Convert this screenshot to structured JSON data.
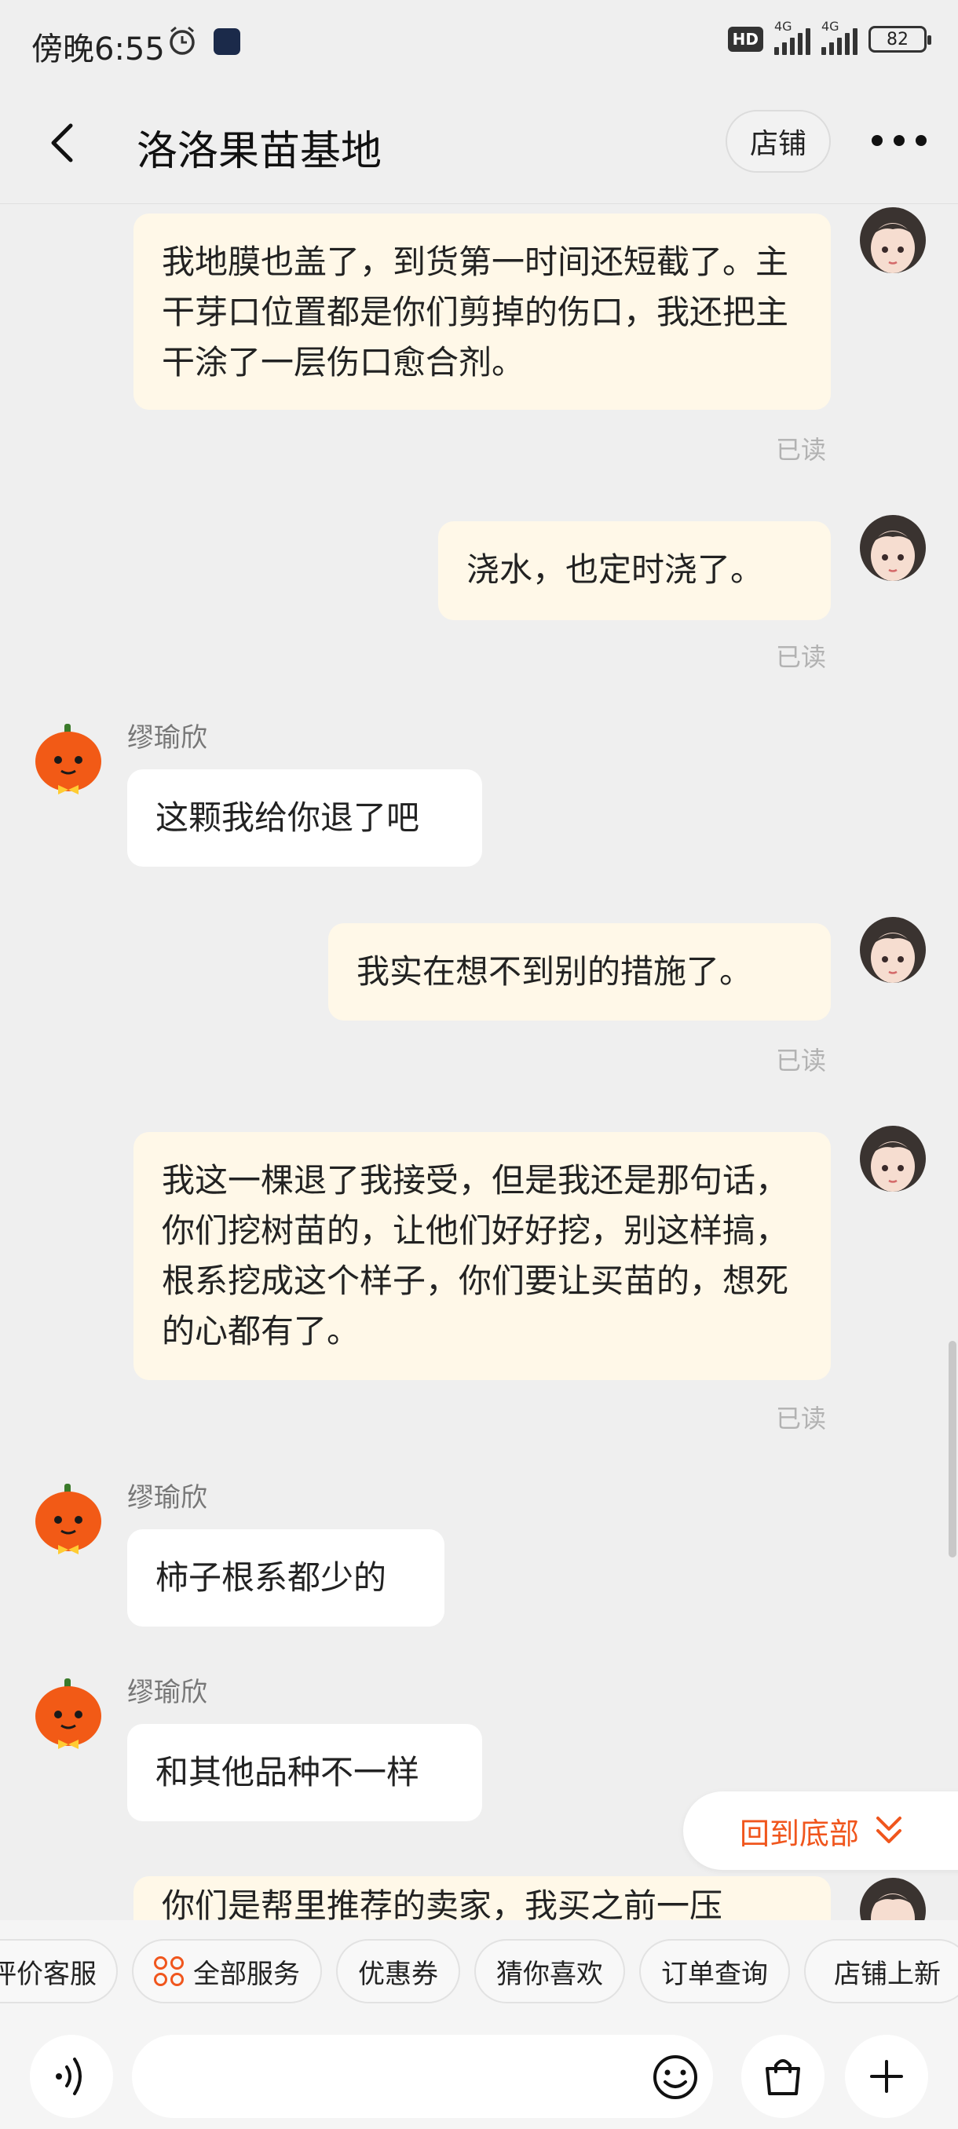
{
  "status_bar": {
    "time": "傍晚6:55",
    "network_badge": "HD",
    "signal_1_label": "4G",
    "signal_2_label": "4G",
    "battery": "82"
  },
  "header": {
    "title": "洛洛果苗基地",
    "shop_button": "店铺"
  },
  "messages": [
    {
      "side": "mine",
      "text": "我地膜也盖了，到货第一时间还短截了。主干芽口位置都是你们剪掉的伤口，我还把主干涂了一层伤口愈合剂。",
      "status": "已读"
    },
    {
      "side": "mine",
      "text": "浇水，也定时浇了。",
      "status": "已读"
    },
    {
      "side": "theirs",
      "sender": "缪瑜欣",
      "text": "这颗我给你退了吧"
    },
    {
      "side": "mine",
      "text": "我实在想不到别的措施了。",
      "status": "已读"
    },
    {
      "side": "mine",
      "text": "我这一棵退了我接受，但是我还是那句话，你们挖树苗的，让他们好好挖，别这样搞，根系挖成这个样子，你们要让买苗的，想死的心都有了。",
      "status": "已读"
    },
    {
      "side": "theirs",
      "sender": "缪瑜欣",
      "text": "柿子根系都少的"
    },
    {
      "side": "theirs",
      "sender": "缪瑜欣",
      "text": "和其他品种不一样"
    },
    {
      "side": "mine",
      "text": "你们是帮里推荐的卖家，我买之前一压"
    }
  ],
  "back_to_bottom": "回到底部",
  "quick_actions": [
    "评价客服",
    "全部服务",
    "优惠券",
    "猜你喜欢",
    "订单查询",
    "店铺上新"
  ],
  "input": {
    "placeholder": ""
  },
  "colors": {
    "accent": "#f0561d",
    "mine_bubble": "#fff8e8",
    "background": "#efefef"
  }
}
